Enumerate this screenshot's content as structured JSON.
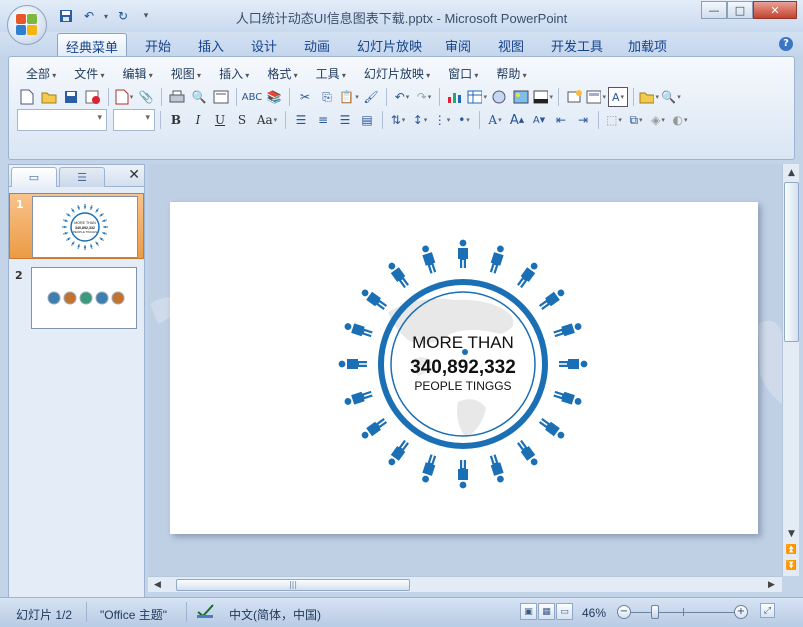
{
  "window": {
    "title": "人口统计动态UI信息图表下载.pptx - Microsoft PowerPoint",
    "minimize": "—",
    "maximize": "□",
    "close": "✕"
  },
  "quick_access": {
    "icons": [
      "save-icon",
      "undo-icon",
      "redo-icon",
      "customize-icon"
    ]
  },
  "ribbon_tabs": [
    {
      "label": "经典菜单",
      "active": true
    },
    {
      "label": "开始"
    },
    {
      "label": "插入"
    },
    {
      "label": "设计"
    },
    {
      "label": "动画"
    },
    {
      "label": "幻灯片放映"
    },
    {
      "label": "审阅"
    },
    {
      "label": "视图"
    },
    {
      "label": "开发工具"
    },
    {
      "label": "加载项"
    }
  ],
  "classic_menus": [
    "全部",
    "文件",
    "编辑",
    "视图",
    "插入",
    "格式",
    "工具",
    "幻灯片放映",
    "窗口",
    "帮助"
  ],
  "format_buttons": {
    "bold": "B",
    "italic": "I",
    "underline": "U",
    "shadow": "S",
    "case": "Aa"
  },
  "slides_pane": {
    "slides": [
      {
        "number": "1",
        "selected": true
      },
      {
        "number": "2",
        "selected": false
      }
    ]
  },
  "slide": {
    "headline": "MORE THAN",
    "number": "340,892,332",
    "subline": "PEOPLE TINGGS",
    "accent_color": "#1a6fb5",
    "people_count": 20
  },
  "status_bar": {
    "slide_indicator": "幻灯片 1/2",
    "theme": "\"Office 主题\"",
    "language": "中文(简体，中国)",
    "zoom": "46%"
  },
  "colors": {
    "ribbon_bg": "#dae6f4",
    "selected_thumb": "#ec9b45",
    "accent": "#1a6fb5"
  }
}
